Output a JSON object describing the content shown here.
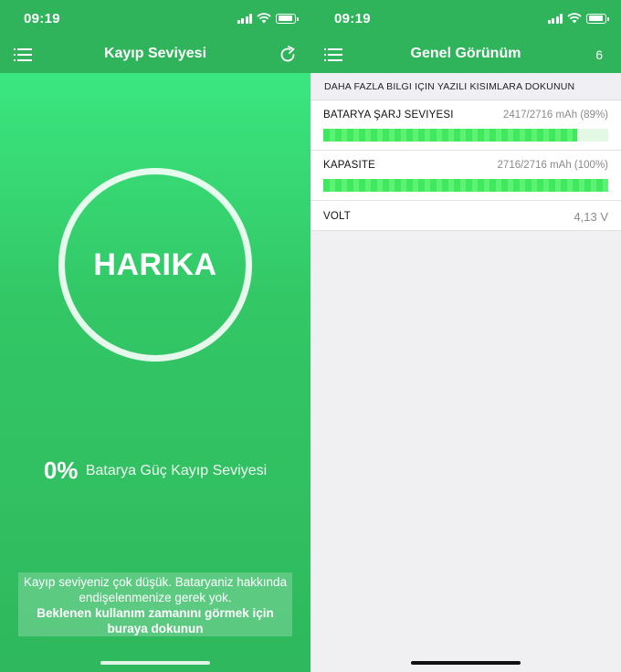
{
  "left_screen": {
    "status_time": "09:19",
    "title": "Kayıp Seviyesi",
    "icons": {
      "menu": "menu-list-icon",
      "refresh": "refresh-icon"
    },
    "ring_label": "HARIKA",
    "loss_value": "0%",
    "loss_label": "Batarya Güç Kayıp Seviyesi",
    "message_line1": "Kayıp seviyeniz çok düşük. Bataryaniz hakkında endişelenmenize gerek yok.",
    "message_line2": "Beklenen kullanım zamanını görmek için buraya dokunun"
  },
  "right_screen": {
    "status_time": "09:19",
    "title": "Genel Görünüm",
    "count": "6",
    "hint": "DAHA FAZLA BILGI IÇIN YAZILI KISIMLARA DOKUNUN",
    "rows": [
      {
        "label": "BATARYA ŞARJ SEVIYESI",
        "value": "2417/2716 mAh (89%)",
        "fill_fraction": 0.89
      },
      {
        "label": "KAPASITE",
        "value": "2716/2716 mAh (100%)",
        "fill_fraction": 1.0
      },
      {
        "label": "VOLT",
        "value": "4,13 V"
      }
    ]
  },
  "colors": {
    "header_green": "#2fb35b",
    "gradient_top": "#3df088",
    "bar_green": "#3fe85c"
  }
}
